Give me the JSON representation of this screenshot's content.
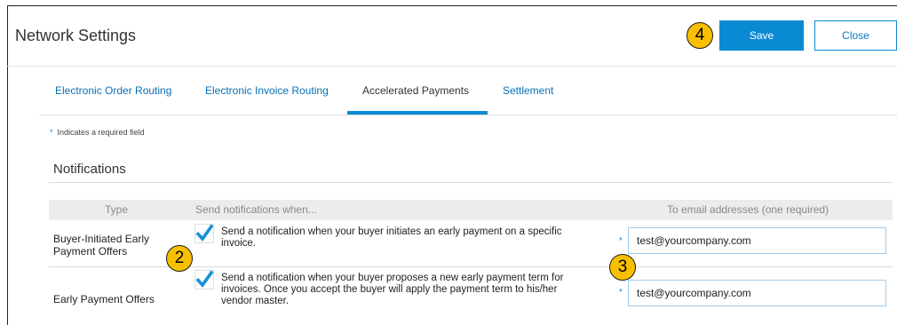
{
  "header": {
    "title": "Network Settings",
    "save_label": "Save",
    "close_label": "Close"
  },
  "tabs": [
    {
      "label": "Electronic Order Routing",
      "active": false
    },
    {
      "label": "Electronic Invoice Routing",
      "active": false
    },
    {
      "label": "Accelerated Payments",
      "active": true
    },
    {
      "label": "Settlement",
      "active": false
    }
  ],
  "required_note": {
    "marker": "*",
    "text": "Indicates a required field"
  },
  "section": {
    "title": "Notifications"
  },
  "table": {
    "columns": [
      "Type",
      "Send notifications when...",
      "To email addresses (one required)"
    ],
    "rows": [
      {
        "type_line1": "Buyer-Initiated Early",
        "type_line2": "Payment Offers",
        "checked": true,
        "desc_line1": "Send a notification when your buyer initiates an early payment on a specific",
        "desc_line2": "invoice.",
        "required_marker": "*",
        "email": "test@yourcompany.com"
      },
      {
        "type_line1": "Early Payment Offers",
        "checked": true,
        "desc_line1": "Send a notification when your buyer proposes a new early payment term for",
        "desc_line2": "invoices. Once you accept the buyer will apply the payment term to his/her",
        "desc_line3": "vendor master.",
        "required_marker": "*",
        "email": "test@yourcompany.com"
      }
    ]
  },
  "callouts": [
    "2",
    "3",
    "4"
  ],
  "colors": {
    "accent": "#0a8ad2",
    "link": "#0a6fb5",
    "callout": "#f8c000",
    "check": "#1a8fd6"
  },
  "icons": {
    "checkbox": "checkmark-icon"
  }
}
